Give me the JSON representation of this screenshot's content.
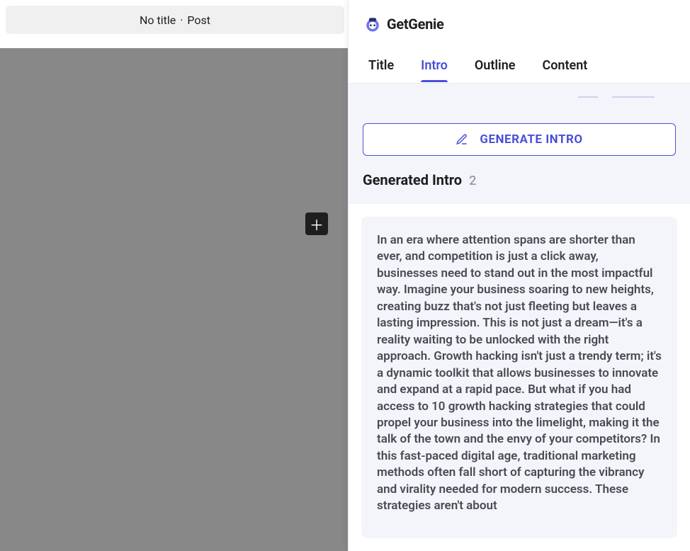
{
  "topbar": {
    "doc_title": "No title",
    "doc_type": "Post"
  },
  "brand": {
    "name": "GetGenie"
  },
  "tabs": [
    {
      "id": "title",
      "label": "Title",
      "active": false
    },
    {
      "id": "intro",
      "label": "Intro",
      "active": true
    },
    {
      "id": "outline",
      "label": "Outline",
      "active": false
    },
    {
      "id": "content",
      "label": "Content",
      "active": false
    }
  ],
  "generate_button": {
    "label": "GENERATE INTRO"
  },
  "section": {
    "title": "Generated Intro",
    "count": "2"
  },
  "results": [
    {
      "text": "In an era where attention spans are shorter than ever, and competition is just a click away, businesses need to stand out in the most impactful way. Imagine your business soaring to new heights, creating buzz that's not just fleeting but leaves a lasting impression. This is not just a dream—it's a reality waiting to be unlocked with the right approach. Growth hacking isn't just a trendy term; it's a dynamic toolkit that allows businesses to innovate and expand at a rapid pace. But what if you had access to 10 growth hacking strategies that could propel your business into the limelight, making it the talk of the town and the envy of your competitors? In this fast-paced digital age, traditional marketing methods often fall short of capturing the vibrancy and virality needed for modern success. These strategies aren't about"
    }
  ]
}
